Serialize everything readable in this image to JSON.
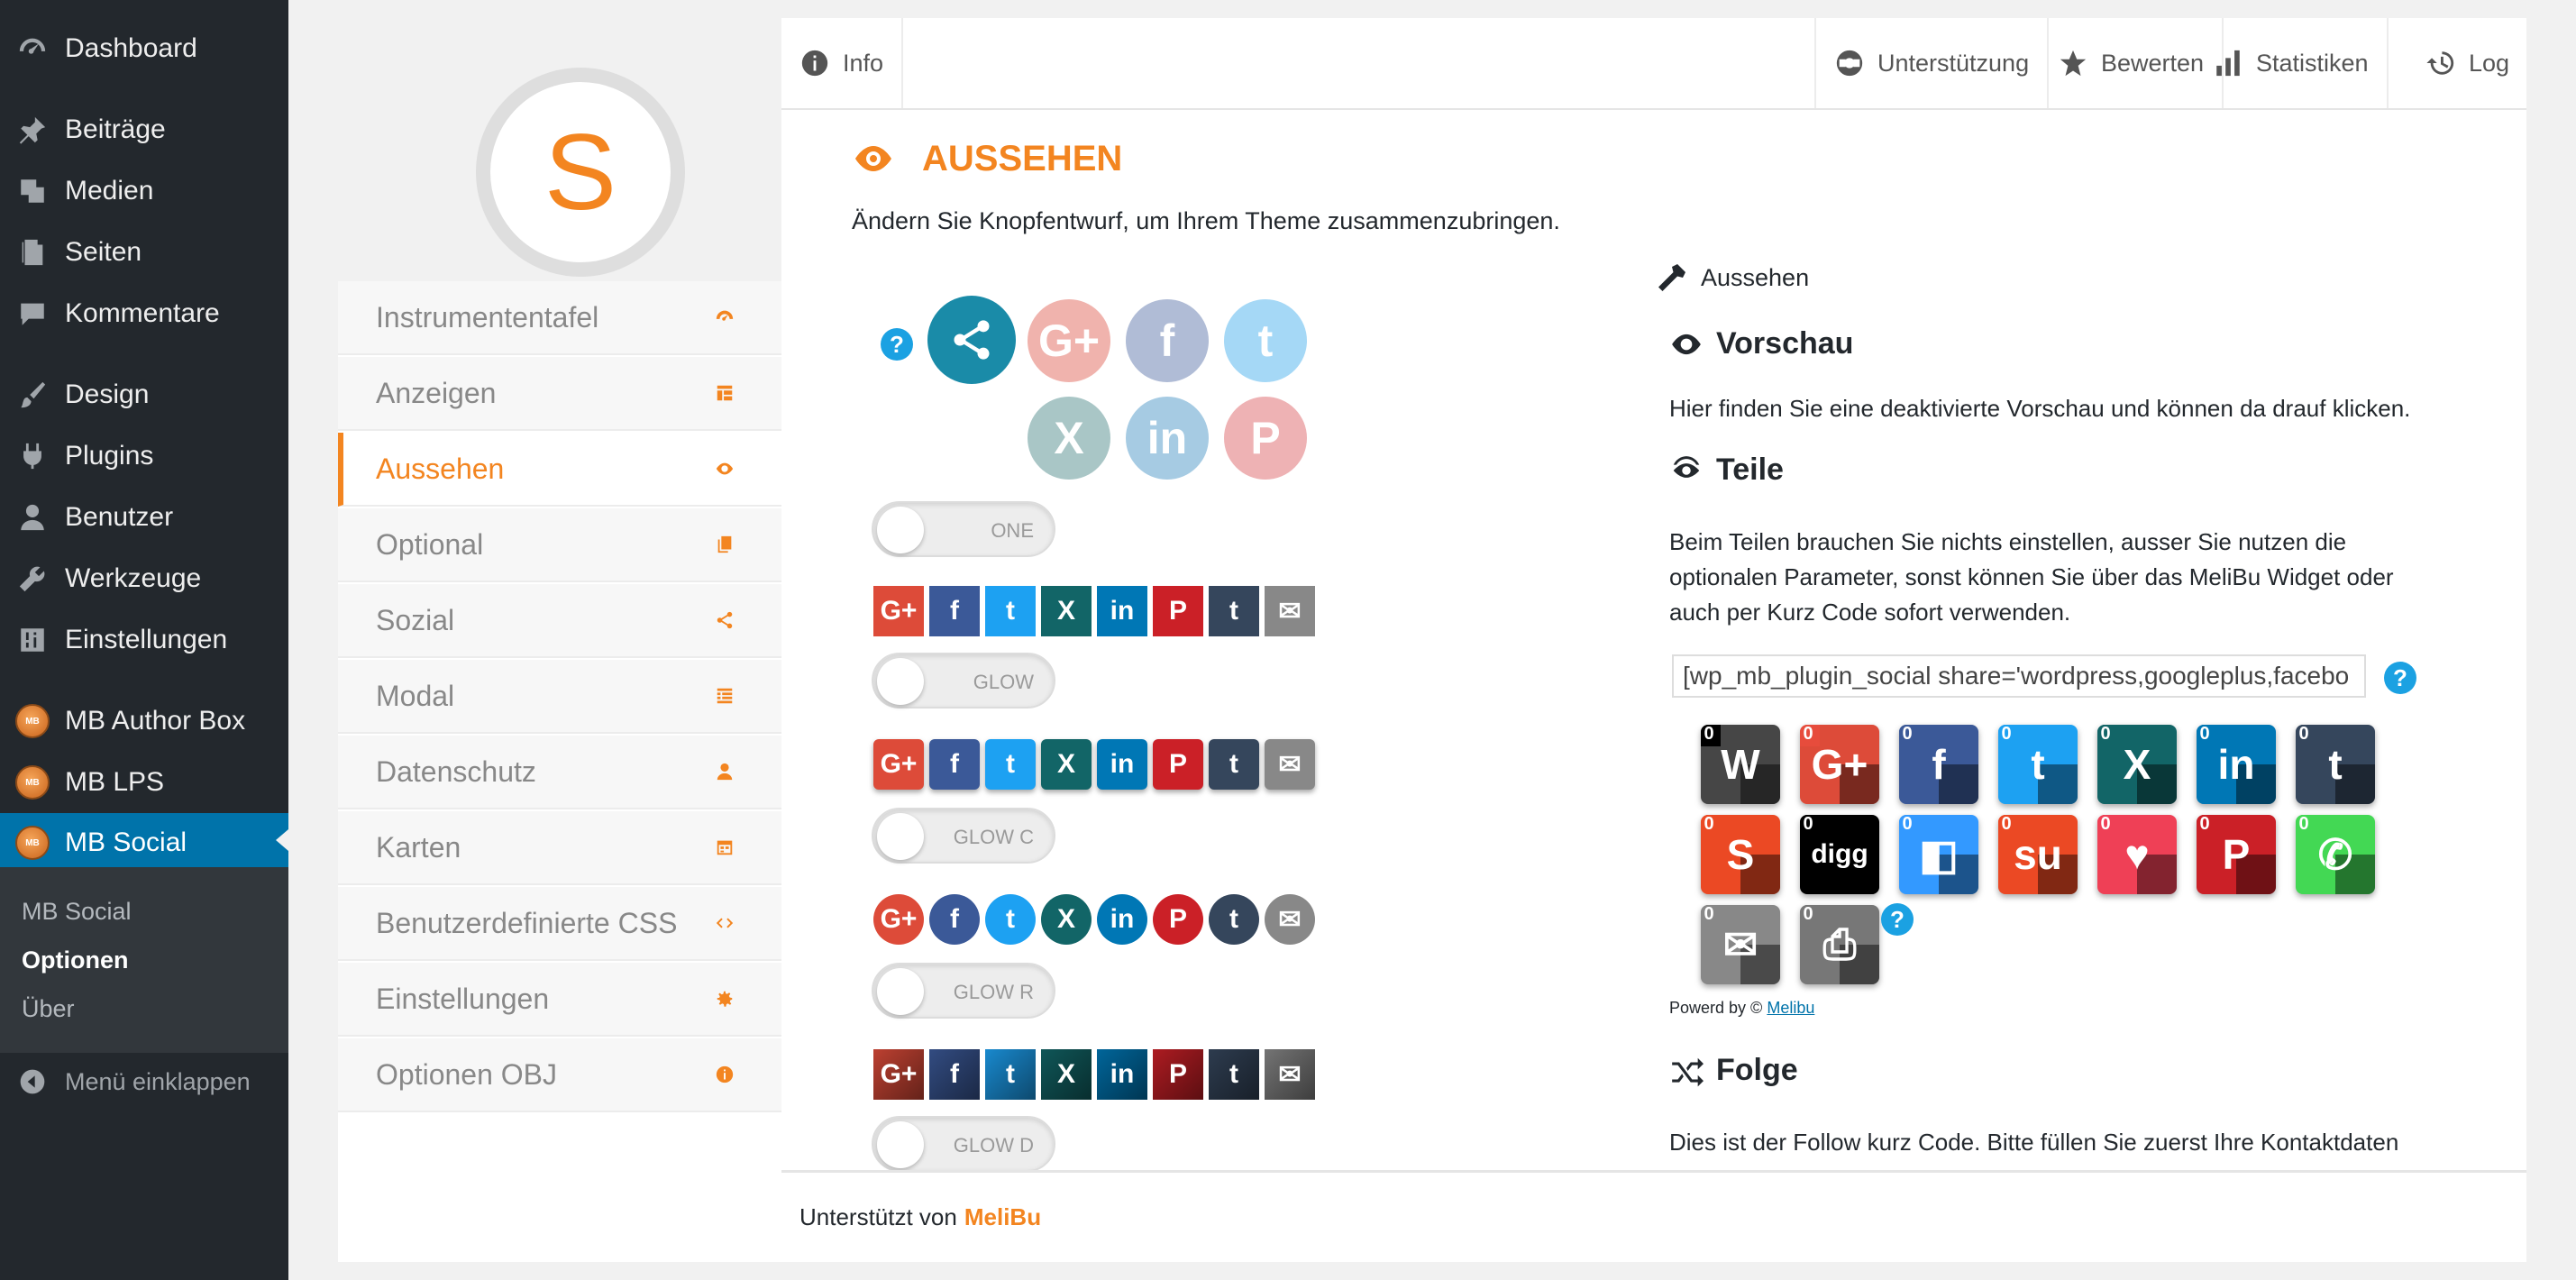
{
  "wp_menu": {
    "items": [
      {
        "label": "Dashboard",
        "icon": "dashboard-icon"
      },
      {
        "label": "Beiträge",
        "icon": "pin-icon"
      },
      {
        "label": "Medien",
        "icon": "media-icon"
      },
      {
        "label": "Seiten",
        "icon": "pages-icon"
      },
      {
        "label": "Kommentare",
        "icon": "comments-icon"
      },
      {
        "label": "Design",
        "icon": "brush-icon"
      },
      {
        "label": "Plugins",
        "icon": "plugins-icon"
      },
      {
        "label": "Benutzer",
        "icon": "user-icon"
      },
      {
        "label": "Werkzeuge",
        "icon": "wrench-icon"
      },
      {
        "label": "Einstellungen",
        "icon": "settings-icon"
      },
      {
        "label": "MB Author Box",
        "icon": "mb-logo-icon"
      },
      {
        "label": "MB LPS",
        "icon": "mb-logo-icon"
      },
      {
        "label": "MB Social",
        "icon": "mb-logo-icon"
      }
    ],
    "submenu": [
      "MB Social",
      "Optionen",
      "Über"
    ],
    "collapse_label": "Menü einklappen"
  },
  "plugin_nav": {
    "logo_letter": "S",
    "items": [
      {
        "label": "Instrumententafel",
        "icon": "dashboard-icon"
      },
      {
        "label": "Anzeigen",
        "icon": "layout-icon"
      },
      {
        "label": "Aussehen",
        "icon": "eye-icon"
      },
      {
        "label": "Optional",
        "icon": "copy-icon"
      },
      {
        "label": "Sozial",
        "icon": "share-icon"
      },
      {
        "label": "Modal",
        "icon": "list-icon"
      },
      {
        "label": "Datenschutz",
        "icon": "user-icon"
      },
      {
        "label": "Karten",
        "icon": "calendar-icon"
      },
      {
        "label": "Benutzerdefinierte CSS",
        "icon": "code-icon"
      },
      {
        "label": "Einstellungen",
        "icon": "gear-icon"
      },
      {
        "label": "Optionen OBJ",
        "icon": "info-icon"
      }
    ],
    "active": "Aussehen"
  },
  "topbar": {
    "info": "Info",
    "support": "Unterstützung",
    "rate": "Bewerten",
    "stats": "Statistiken",
    "log": "Log"
  },
  "section": {
    "title": "AUSSEHEN",
    "description": "Ändern Sie Knopfentwurf, um Ihrem Theme zusammenzubringen."
  },
  "toggles": [
    "ONE",
    "GLOW",
    "GLOW C",
    "GLOW R",
    "GLOW D"
  ],
  "colors": {
    "accent": "#f38520",
    "wp_blue": "#0073aa",
    "google": "#dd4b39",
    "facebook": "#3b5998",
    "twitter": "#1da1f2",
    "xing": "#126567",
    "linkedin": "#0077b5",
    "pinterest": "#cb2027",
    "tumblr": "#35465c",
    "mail": "#888888",
    "share": "#1a8ba8",
    "wordpress": "#464646",
    "stumble": "#eb4924",
    "digg": "#000000",
    "delicious": "#3399ff",
    "pocket": "#ef4056",
    "whatsapp": "#43d854",
    "print": "#777777"
  },
  "button_glyphs": {
    "google": "G+",
    "facebook": "f",
    "twitter": "t",
    "xing": "X",
    "linkedin": "in",
    "pinterest": "P",
    "tumblr": "t",
    "mail": "✉"
  },
  "preview": {
    "header": "Aussehen",
    "vorschau_title": "Vorschau",
    "vorschau_text": "Hier finden Sie eine deaktivierte Vorschau und können da drauf klicken.",
    "teile_title": "Teile",
    "teile_text": "Beim Teilen brauchen Sie nichts einstellen, ausser Sie nutzen die optionalen Parameter, sonst können Sie über das MeliBu Widget oder auch per Kurz Code sofort verwenden.",
    "shortcode": "[wp_mb_plugin_social share='wordpress,googleplus,facebo",
    "counts": [
      "0",
      "0",
      "0",
      "0",
      "0",
      "0",
      "0",
      "0",
      "0",
      "0",
      "0",
      "0",
      "0",
      "0",
      "0",
      "0"
    ],
    "powered_prefix": "Powerd by ©",
    "powered_link": "Melibu",
    "folge_title": "Folge",
    "folge_text": "Dies ist der Follow kurz Code. Bitte füllen Sie zuerst Ihre Kontaktdaten"
  },
  "footer": {
    "prefix": "Unterstützt von",
    "brand": "MeliBu"
  }
}
